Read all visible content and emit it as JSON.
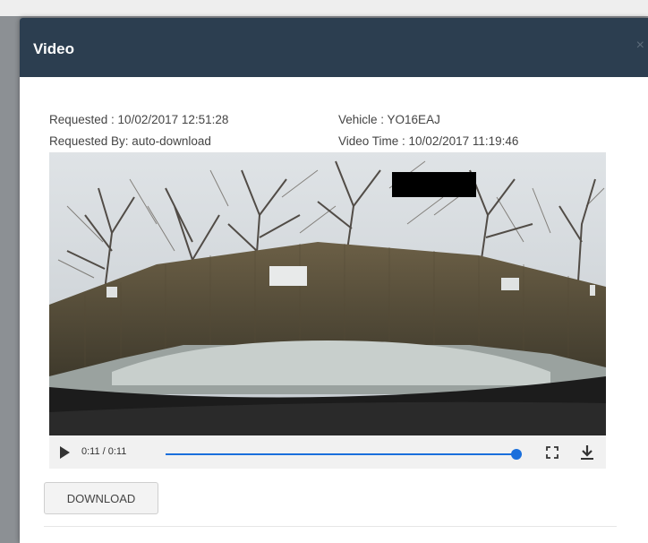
{
  "modal": {
    "title": "Video",
    "close_label": "×"
  },
  "info": {
    "requested": "Requested : 10/02/2017 12:51:28",
    "requested_by": "Requested By: auto-download",
    "vehicle": "Vehicle : YO16EAJ",
    "video_time": "Video Time : 10/02/2017 11:19:46"
  },
  "player": {
    "time_display": "0:11 / 0:11",
    "progress": 1.0,
    "accent_color": "#1a6fdc",
    "icons": [
      "play-icon",
      "fullscreen-icon",
      "download-icon"
    ]
  },
  "actions": {
    "download_label": "DOWNLOAD"
  }
}
